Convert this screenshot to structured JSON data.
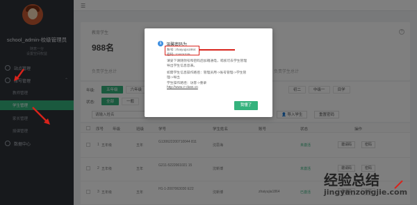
{
  "sidebar": {
    "username": "school_admin-校级管理员",
    "sub1": "随意一分",
    "sub2": "设置空间权益",
    "items": [
      {
        "label": "站点管理"
      },
      {
        "label": "账号管理"
      },
      {
        "label": "数据中心"
      }
    ],
    "subitems": [
      {
        "label": "教师管理"
      },
      {
        "label": "学生管理"
      },
      {
        "label": "家长管理"
      },
      {
        "label": "授课管理"
      }
    ]
  },
  "summary": {
    "label": "教育学生",
    "count": "988名",
    "footer_left": "负责学生总计",
    "footer_right": "负责学生总计"
  },
  "filters": {
    "grade_label": "年级:",
    "grades": [
      "五年级",
      "六年级",
      "初二",
      "中级一",
      "目学"
    ],
    "status_label": "状态:",
    "statuses": [
      "全部",
      "一般"
    ],
    "search_placeholder": "请输入姓名",
    "btn_import": "导入学生",
    "btn_reset": "重置密码"
  },
  "table": {
    "headers": [
      "序号",
      "年级",
      "班级",
      "学号",
      "学生姓名",
      "账号",
      "状态",
      "操作"
    ],
    "rows": [
      {
        "index": "1",
        "grade": "五年级",
        "cls": "五年",
        "id": "G130622200710044 811",
        "name": "沈思海",
        "account": "",
        "status": "未激活",
        "op1": "邀请码",
        "op2": "密码"
      },
      {
        "index": "2",
        "grade": "五年级",
        "cls": "五年",
        "id": "G211-5222061021 15",
        "name": "沈新博",
        "account": "",
        "status": "未激活",
        "op1": "邀请码",
        "op2": "密码"
      },
      {
        "index": "3",
        "grade": "五年级",
        "cls": "五年",
        "id": "H1-1-2007063030 E22",
        "name": "沈新博",
        "account": "zhaiyujia1864",
        "status": "已激活",
        "op1": "邀请码",
        "op2": "密码"
      }
    ]
  },
  "modal": {
    "number": "1",
    "title": "温馨密码为",
    "account_line": "账号: zhaiyujia1864",
    "password_line": "密码: 21674225",
    "hint1": "请妥下请随领号和密码后加箱通电，或核可去学生管理",
    "hint2": "导出学生信息息表。",
    "hint3": "如需学生信息操作路径：管理员用->账号管理->学生管",
    "hint4": "理->导出",
    "hint5": "学生操作路径：访客->重录",
    "link": "http://www.z-class.cn",
    "ok_label": "我懂了"
  },
  "watermark": {
    "big": "经验总结",
    "small": "jingyanzongjie.com"
  },
  "colors": {
    "accent": "#35b27d",
    "sidebar": "#2f3238",
    "annotation": "#d8231b",
    "badge": "#3b8de0"
  }
}
